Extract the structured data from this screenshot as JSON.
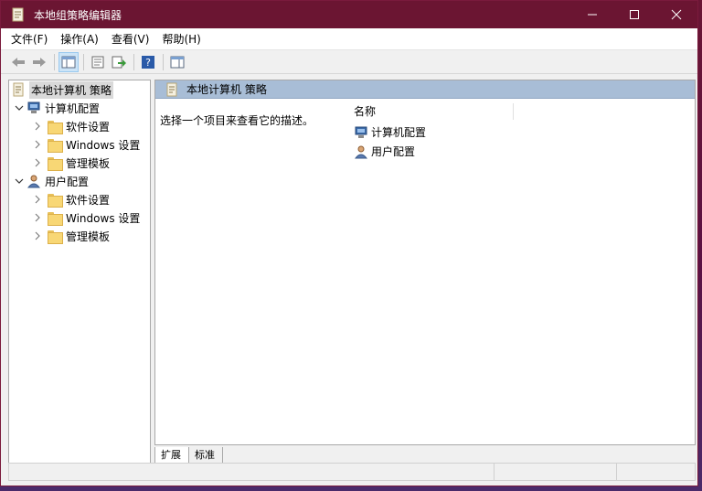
{
  "window": {
    "title": "本地组策略编辑器",
    "controls": {
      "minimize": "—",
      "maximize": "☐",
      "close": "✕"
    }
  },
  "menu": [
    "文件(F)",
    "操作(A)",
    "查看(V)",
    "帮助(H)"
  ],
  "toolbar": {
    "buttons": [
      "back-icon",
      "forward-icon",
      "show-hide-tree-icon",
      "properties-icon",
      "export-list-icon",
      "help-icon",
      "show-hide-action-pane-icon"
    ]
  },
  "tree": {
    "root": "本地计算机 策略",
    "computer": {
      "label": "计算机配置",
      "children": [
        "软件设置",
        "Windows 设置",
        "管理模板"
      ]
    },
    "user": {
      "label": "用户配置",
      "children": [
        "软件设置",
        "Windows 设置",
        "管理模板"
      ]
    }
  },
  "right": {
    "header": "本地计算机 策略",
    "description": "选择一个项目来查看它的描述。",
    "column": "名称",
    "items": [
      "计算机配置",
      "用户配置"
    ]
  },
  "tabs": [
    "扩展",
    "标准"
  ],
  "colors": {
    "titlebar": "#6b1532",
    "header_band": "#a8bdd6"
  }
}
